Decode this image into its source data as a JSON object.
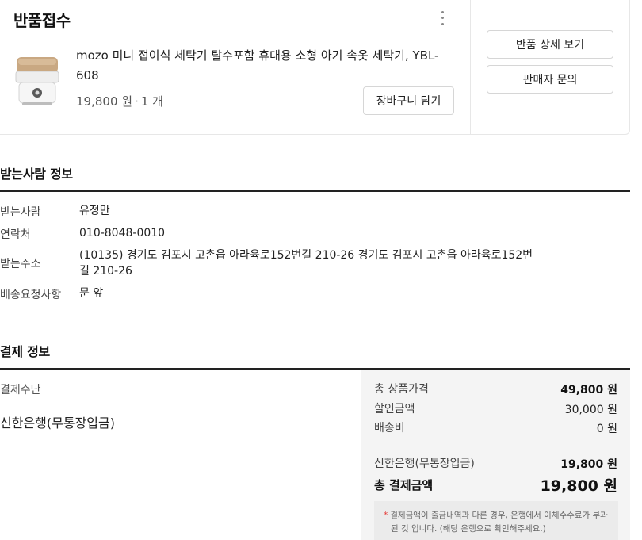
{
  "return_card": {
    "status_title": "반품접수",
    "product": {
      "name": "mozo 미니 접이식 세탁기 탈수포함 휴대용 소형 아기 속옷 세탁기, YBL-608",
      "price": "19,800 원",
      "quantity": "1 개"
    },
    "cart_button": "장바구니 담기",
    "detail_button": "반품 상세 보기",
    "seller_button": "판매자 문의"
  },
  "recipient": {
    "title": "받는사람 정보",
    "rows": [
      {
        "label": "받는사람",
        "value": "유정만"
      },
      {
        "label": "연락처",
        "value": "010-8048-0010"
      },
      {
        "label": "받는주소",
        "value_line1": "(10135) 경기도 김포시 고촌읍 아라육로152번길 210-26 경기도 김포시 고촌읍 아라육로152번",
        "value_line2": "길 210-26"
      },
      {
        "label": "배송요청사항",
        "value": "문 앞"
      }
    ]
  },
  "payment": {
    "title": "결제 정보",
    "method_label": "결제수단",
    "method_value": "신한은행(무통장입금)",
    "summary": {
      "items": [
        {
          "label": "총 상품가격",
          "value": "49,800 원"
        },
        {
          "label": "할인금액",
          "value": "30,000 원"
        },
        {
          "label": "배송비",
          "value": "0 원"
        }
      ],
      "bank": {
        "label": "신한은행(무통장입금)",
        "value": "19,800 원"
      },
      "total": {
        "label": "총 결제금액",
        "value": "19,800 원"
      }
    },
    "notice_line1": "결제금액이 출금내역과 다른 경우, 은행에서 이체수수료가 부과",
    "notice_line2": "된 것 입니다. (해당 은행으로 확인해주세요.)"
  }
}
